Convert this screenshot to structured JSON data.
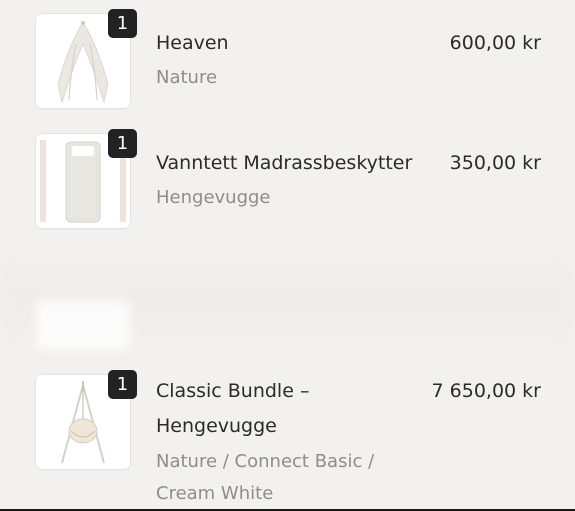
{
  "cart": {
    "items": [
      {
        "name": "Heaven",
        "variant": "Nature",
        "price": "600,00 kr",
        "quantity": "1",
        "icon": "canopy-icon"
      },
      {
        "name": "Vanntett Madrassbeskytter",
        "variant": "Hengevugge",
        "price": "350,00 kr",
        "quantity": "1",
        "icon": "mattress-protector-icon"
      },
      {
        "name": "Classic Bundle –\nHengevugge",
        "variant": "Nature / Connect Basic /\nCream White",
        "price": "7 650,00 kr",
        "quantity": "1",
        "icon": "cradle-stand-icon"
      }
    ]
  },
  "colors": {
    "background": "#f2f1ef",
    "text_primary": "#2b2b2b",
    "text_secondary": "#8d8d8d",
    "badge": "#222222"
  }
}
